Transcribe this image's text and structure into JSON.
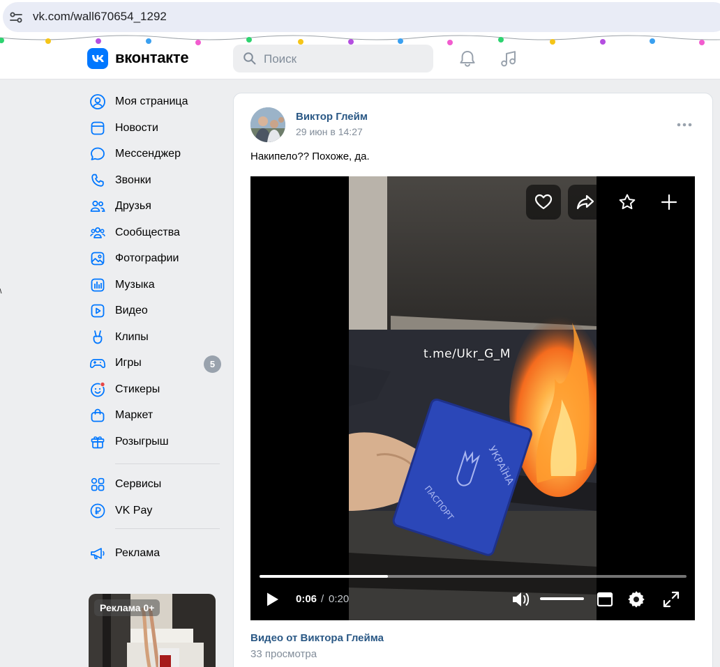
{
  "browser": {
    "url": "vk.com/wall670654_1292"
  },
  "header": {
    "logo_text": "вконтакте",
    "search_placeholder": "Поиск"
  },
  "sidebar": {
    "items": [
      {
        "label": "Моя страница",
        "icon": "user-circle-icon"
      },
      {
        "label": "Новости",
        "icon": "news-icon"
      },
      {
        "label": "Мессенджер",
        "icon": "message-icon"
      },
      {
        "label": "Звонки",
        "icon": "phone-icon"
      },
      {
        "label": "Друзья",
        "icon": "friends-icon"
      },
      {
        "label": "Сообщества",
        "icon": "communities-icon"
      },
      {
        "label": "Фотографии",
        "icon": "photo-icon"
      },
      {
        "label": "Музыка",
        "icon": "music-icon"
      },
      {
        "label": "Видео",
        "icon": "video-icon"
      },
      {
        "label": "Клипы",
        "icon": "clips-icon"
      },
      {
        "label": "Игры",
        "icon": "gamepad-icon"
      },
      {
        "label": "Стикеры",
        "icon": "sticker-icon"
      },
      {
        "label": "Маркет",
        "icon": "market-icon"
      },
      {
        "label": "Розыгрыш",
        "icon": "gift-icon"
      }
    ],
    "games_badge": "5",
    "extra_items": [
      {
        "label": "Сервисы",
        "icon": "services-icon"
      },
      {
        "label": "VK Pay",
        "icon": "vkpay-icon"
      }
    ],
    "ads_item": {
      "label": "Реклама",
      "icon": "megaphone-icon"
    },
    "ad_label": "Реклама 0+"
  },
  "post": {
    "author": "Виктор Глейм",
    "date": "29 июн в 14:27",
    "text": "Накипело?? Похоже, да.",
    "video": {
      "watermark": "t.me/Ukr_G_M",
      "time_current": "0:06",
      "time_separator": "/",
      "time_total": "0:20",
      "progress": 0.3,
      "volume": 1.0
    },
    "video_title": "Видео от Виктора Глейма",
    "views": "33 просмотра"
  },
  "colors": {
    "vk_blue": "#0077ff",
    "link": "#2a5885",
    "muted": "#818c99",
    "page_bg": "#edeef0"
  }
}
